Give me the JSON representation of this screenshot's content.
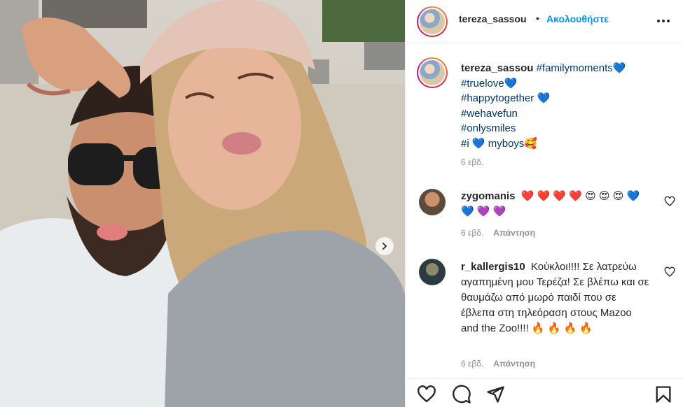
{
  "header": {
    "username": "tereza_sassou",
    "separator": "•",
    "follow_label": "Ακολουθήστε"
  },
  "caption": {
    "username": "tereza_sassou",
    "tags": [
      "#familymoments",
      "#truelove",
      "#happytogether",
      "#wehavefun",
      "#onlysmiles"
    ],
    "last_line_prefix": "#i",
    "last_line_suffix": "myboys",
    "hearts": "💙",
    "smile_emoji": "🥰",
    "time": "6 εβδ."
  },
  "comments": [
    {
      "username": "zygomanis",
      "text": "❤️ ❤️ ❤️ ❤️ 😍 😍 😍 💙 💙 💜 💜",
      "time": "6 εβδ.",
      "reply_label": "Απάντηση"
    },
    {
      "username": "r_kallergis10",
      "text": "Κούκλοι!!!! Σε λατρεύω αγαπημένη μου Τερέζα! Σε βλέπω και σε θαυμάζω από μωρό παιδί που σε έβλεπα στη τηλεόραση στους Mazoo and the Zoo!!!! 🔥 🔥 🔥 🔥",
      "time": "6 εβδ.",
      "reply_label": "Απάντηση"
    }
  ],
  "icons": {
    "more": "more-horizontal-icon",
    "next": "chevron-right-icon",
    "like": "heart-icon",
    "comment": "comment-icon",
    "share": "send-icon",
    "save": "bookmark-icon"
  },
  "colors": {
    "link": "#00376b",
    "follow": "#0095f6",
    "muted": "#8e8e8e"
  }
}
